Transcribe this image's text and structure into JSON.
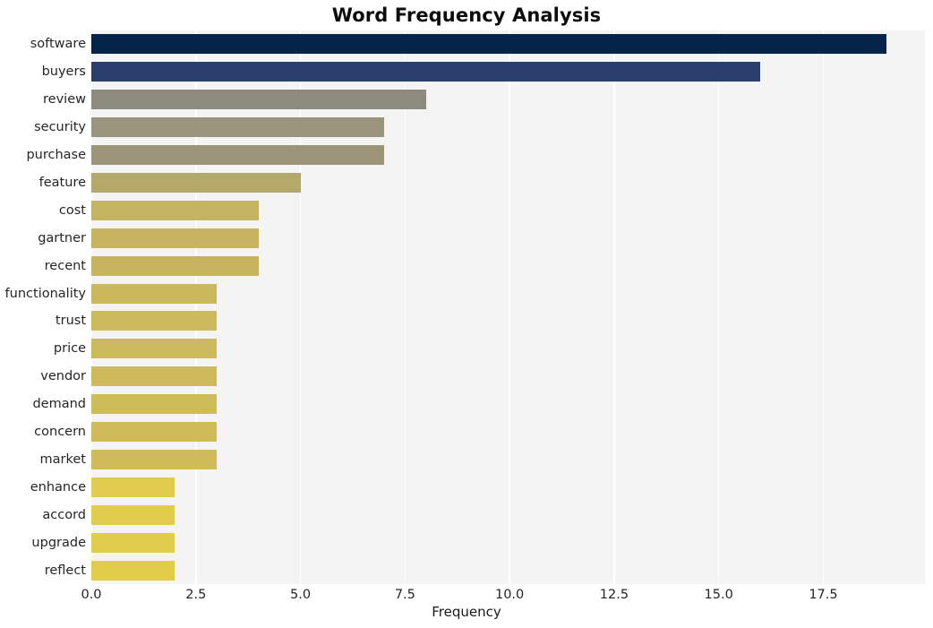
{
  "chart_data": {
    "type": "bar",
    "orientation": "horizontal",
    "title": "Word Frequency Analysis",
    "xlabel": "Frequency",
    "ylabel": "",
    "categories": [
      "software",
      "buyers",
      "review",
      "security",
      "purchase",
      "feature",
      "cost",
      "gartner",
      "recent",
      "functionality",
      "trust",
      "price",
      "vendor",
      "demand",
      "concern",
      "market",
      "enhance",
      "accord",
      "upgrade",
      "reflect"
    ],
    "values": [
      19,
      16,
      8,
      7,
      7,
      5,
      4,
      4,
      4,
      3,
      3,
      3,
      3,
      3,
      3,
      3,
      2,
      2,
      2,
      2
    ],
    "bar_colors": [
      "#06234a",
      "#2b3f6e",
      "#8d8b7e",
      "#9a947c",
      "#9c9478",
      "#b5a86b",
      "#c5b462",
      "#c6b461",
      "#c6b460",
      "#cbb85d",
      "#cdba5c",
      "#cdba5c",
      "#ceba5b",
      "#cebb5a",
      "#cfbb5a",
      "#cfbc59",
      "#e0cb4e",
      "#e1cc4d",
      "#e1cc4c",
      "#e2cd4b"
    ],
    "xlim": [
      0,
      19.93
    ],
    "ylim_categories": 20,
    "x_ticks": [
      "0.0",
      "2.5",
      "5.0",
      "7.5",
      "10.0",
      "12.5",
      "15.0",
      "17.5"
    ],
    "x_tick_values": [
      0,
      2.5,
      5,
      7.5,
      10,
      12.5,
      15,
      17.5
    ],
    "grid": true,
    "grid_axis": "x",
    "grid_color": "#ffffff",
    "plot_background": "#f4f4f4",
    "figure_background": "#ffffff",
    "legend": null
  }
}
